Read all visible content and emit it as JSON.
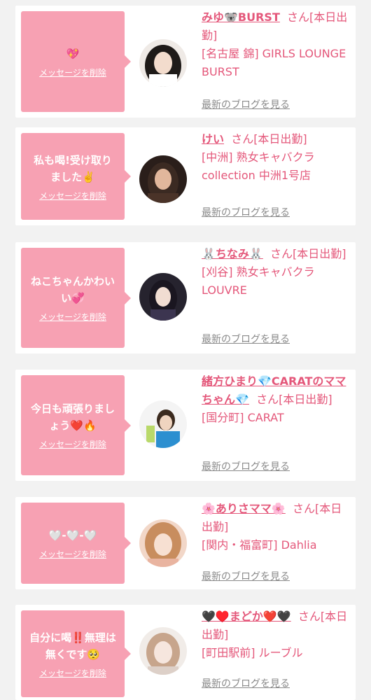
{
  "colors": {
    "background": "#f2f2f2",
    "card": "#ffffff",
    "bubble": "#f7a1b3",
    "accent": "#e4577a",
    "link_gray": "#8a8a8a"
  },
  "cards": [
    {
      "message": "💖",
      "delete_label": "メッセージを削除",
      "name": "みゆ🐨BURST",
      "suffix": "さん[本日出勤]",
      "shop": "[名古屋 錦] GIRLS LOUNGE BURST",
      "blog_label": "最新のブログを見る",
      "avatar_icon": "woman-portrait-avatar"
    },
    {
      "message": "私も喝!受け取りました✌️",
      "delete_label": "メッセージを削除",
      "name": "けい",
      "suffix": "さん[本日出勤]",
      "shop": "[中洲] 熟女キャバクラcollection 中洲1号店",
      "blog_label": "最新のブログを見る",
      "avatar_icon": "woman-portrait-avatar"
    },
    {
      "message": "ねこちゃんかわいい💞",
      "delete_label": "メッセージを削除",
      "name": "🐰ちなみ🐰",
      "suffix": "さん[本日出勤]",
      "shop": "[刈谷] 熟女キャバクラLOUVRE",
      "blog_label": "最新のブログを見る",
      "avatar_icon": "woman-portrait-avatar"
    },
    {
      "message": "今日も頑張りましょう❤️🔥",
      "delete_label": "メッセージを削除",
      "name": "緒方ひまり💎CARATのママちゃん💎",
      "suffix": "さん[本日出勤]",
      "shop": "[国分町] CARAT",
      "blog_label": "最新のブログを見る",
      "avatar_icon": "woman-portrait-avatar"
    },
    {
      "message": "🤍-🤍-🤍",
      "delete_label": "メッセージを削除",
      "name": "🌸ありさママ🌸",
      "suffix": "さん[本日出勤]",
      "shop": "[関内・福富町] Dahlia",
      "blog_label": "最新のブログを見る",
      "avatar_icon": "woman-portrait-avatar"
    },
    {
      "message": "自分に喝‼️無理は無くです🥺",
      "delete_label": "メッセージを削除",
      "name": "🖤♥️まどか❤️🖤",
      "suffix": "さん[本日出勤]",
      "shop": "[町田駅前] ルーブル",
      "blog_label": "最新のブログを見る",
      "avatar_icon": "woman-portrait-avatar"
    }
  ]
}
